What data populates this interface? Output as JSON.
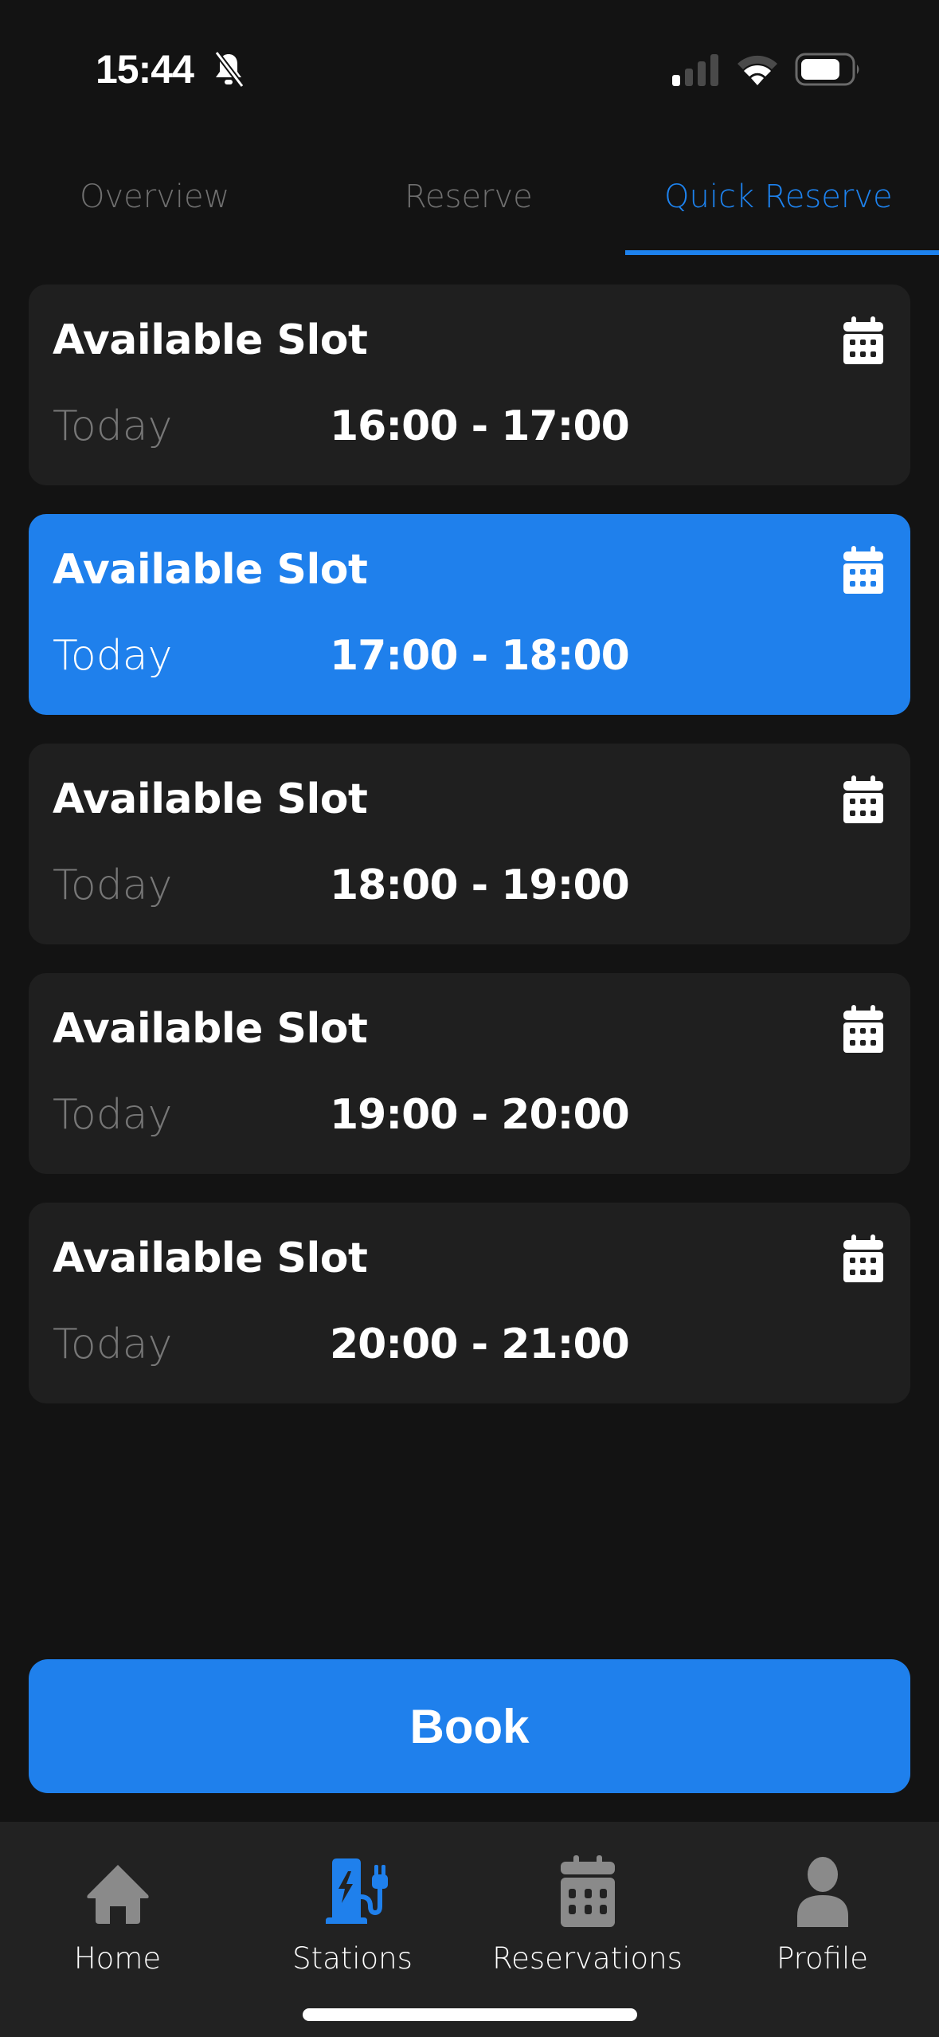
{
  "status_bar": {
    "time": "15:44",
    "silent_mode": true,
    "signal_bars": 1,
    "signal_total": 4,
    "battery_level": 0.75
  },
  "tabs": [
    {
      "label": "Overview",
      "active": false
    },
    {
      "label": "Reserve",
      "active": false
    },
    {
      "label": "Quick Reserve",
      "active": true
    }
  ],
  "slots": [
    {
      "title": "Available Slot",
      "day": "Today",
      "time": "16:00 - 17:00",
      "selected": false,
      "icon": "calendar-icon"
    },
    {
      "title": "Available Slot",
      "day": "Today",
      "time": "17:00 - 18:00",
      "selected": true,
      "icon": "calendar-icon"
    },
    {
      "title": "Available Slot",
      "day": "Today",
      "time": "18:00 - 19:00",
      "selected": false,
      "icon": "calendar-icon"
    },
    {
      "title": "Available Slot",
      "day": "Today",
      "time": "19:00 - 20:00",
      "selected": false,
      "icon": "calendar-icon"
    },
    {
      "title": "Available Slot",
      "day": "Today",
      "time": "20:00 - 21:00",
      "selected": false,
      "icon": "calendar-icon"
    }
  ],
  "book_button": {
    "label": "Book"
  },
  "bottom_nav": [
    {
      "label": "Home",
      "icon": "home-icon",
      "active": false
    },
    {
      "label": "Stations",
      "icon": "ev-station-icon",
      "active": true
    },
    {
      "label": "Reservations",
      "icon": "calendar-icon",
      "active": false
    },
    {
      "label": "Profile",
      "icon": "person-icon",
      "active": false
    }
  ],
  "colors": {
    "accent": "#1f80ec",
    "background": "#131313",
    "card": "#1f1f1f",
    "nav_background": "#222222",
    "inactive_icon": "#8a8a8a",
    "inactive_text": "#6f6f6f"
  }
}
